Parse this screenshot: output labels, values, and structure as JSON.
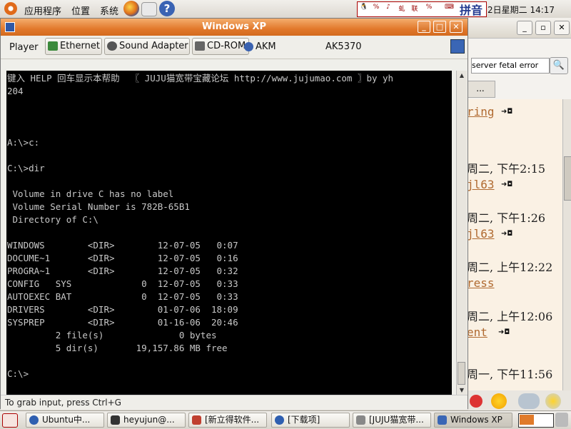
{
  "top_panel": {
    "menus": [
      "应用程序",
      "位置",
      "系统"
    ],
    "tray_items": [
      "🐧",
      "%",
      "♪",
      "虬",
      "联",
      "%",
      "⌨"
    ],
    "input_method": "拼音",
    "clock": "2日星期二 14:17"
  },
  "vm_window": {
    "title": "Windows XP",
    "menu": "Player",
    "devices": [
      {
        "label": "Ethernet",
        "color": "#3c8a3c"
      },
      {
        "label": "Sound Adapter",
        "color": "#555555"
      },
      {
        "label": "CD-ROM",
        "color": "#666666"
      }
    ],
    "akm_label": "AKM",
    "ak_model": "AK5370",
    "status_text": "To grab input, press Ctrl+G"
  },
  "console": {
    "lines": [
      "键入 HELP 回车显示本帮助  〖 JUJU猫宽带宝藏论坛 http://www.jujumao.com 〗by yh",
      "204",
      "",
      "",
      "",
      "A:\\>c:",
      "",
      "C:\\>dir",
      "",
      " Volume in drive C has no label",
      " Volume Serial Number is 782B-65B1",
      " Directory of C:\\",
      "",
      "WINDOWS        <DIR>        12-07-05   0:07",
      "DOCUME~1       <DIR>        12-07-05   0:16",
      "PROGRA~1       <DIR>        12-07-05   0:32",
      "CONFIG   SYS             0  12-07-05   0:33",
      "AUTOEXEC BAT             0  12-07-05   0:33",
      "DRIVERS        <DIR>        01-07-06  18:09",
      "SYSPREP        <DIR>        01-16-06  20:46",
      "         2 file(s)              0 bytes",
      "         5 dir(s)       19,157.86 MB free",
      "",
      "C:\\>"
    ]
  },
  "bg_app": {
    "search_value": "server fetal error",
    "tab_label": "...",
    "items": [
      {
        "link": "ring",
        "date": null
      },
      {
        "link": "jl63",
        "date": "周二, 下午2:15"
      },
      {
        "link": "jl63",
        "date": "周二, 下午1:26"
      },
      {
        "link": "ress",
        "date": "周二, 上午12:22"
      },
      {
        "link": "ent",
        "date": "周二, 上午12:06"
      },
      {
        "link": null,
        "date": "周一, 下午11:56"
      }
    ]
  },
  "taskbar": {
    "tasks": [
      {
        "label": "Ubuntu中...",
        "color": "#2f5fb0"
      },
      {
        "label": "heyujun@...",
        "color": "#333333"
      },
      {
        "label": "[新立得软件...",
        "color": "#c04030"
      },
      {
        "label": "[下载项]",
        "color": "#2f5fb0"
      },
      {
        "label": "[JUJU猫宽带...",
        "color": "#888888"
      },
      {
        "label": "Windows XP",
        "color": "#3a66b5"
      }
    ]
  }
}
